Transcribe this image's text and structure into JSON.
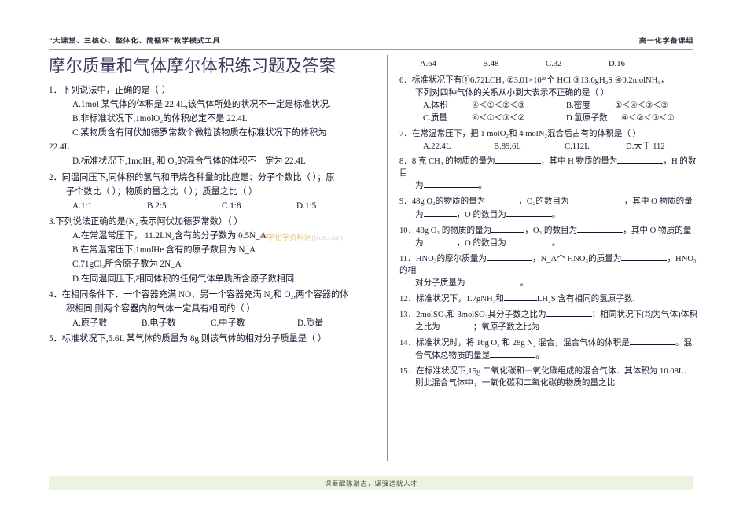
{
  "header": {
    "left": "“大课堂、三核心、整体化、简循环”教学模式工具",
    "right": "高一化学备课组"
  },
  "title": "摩尔质量和气体摩尔体积练习题及答案",
  "watermark": {
    "text": "中学化学资料网",
    "url": "(jxue.com)"
  },
  "footer": {
    "text": "课吾醒陈激志，坚强造就人才"
  },
  "left_column": {
    "q1": {
      "stem": "1．下列说法中，正确的是",
      "paren": "（          ）",
      "options": [
        "A.1mol 某气体的体积是 22.4L,该气体所处的状况不一定是标准状况.",
        "B.非标准状况下,1molO₂的体积必定不是 22.4L",
        "C.某物质含有阿伏加德罗常数个微粒该物质在标准状况下的体积为",
        "22.4L",
        "D.标准状况下,1molH₂ 和 O₂的混合气体的体积不一定为 22.4L"
      ]
    },
    "q2": {
      "line1": "2．同温同压下,同体积的氢气和甲烷各种量的比应是：分子个数比（        ）；原",
      "line2": "子个数比（     ）；物质的量之比（     ）；质量之比（     ）",
      "choices": [
        "A.1:1",
        "B.2:5",
        "C.1:8",
        "D.1:5"
      ]
    },
    "q3": {
      "stem": "3.下列说法正确的是(N",
      "stem_sub": "A",
      "stem_rest": "表示阿伏加德罗常数）（        ）",
      "options": [
        "A.在常温常压下， 11.2LN₂含有的分子数为 0.5N_A",
        "B.在常温常压下,1molHe 含有的原子数目为 N_A",
        "C.71gCl₂所含原子数为 2N_A",
        "D.在同温同压下,相同体积的任何气体单质所含原子数相同"
      ]
    },
    "q4": {
      "line1": "4．在相同条件下．一个容器充满 NO，另一个容器充满 N₂和 O₂,两个容器的体",
      "line2": "积相同.则两个容器内的气体一定具有相同的（      ）",
      "choices": [
        "A.原子数",
        "B.电子数",
        "C.中子数",
        "D.质量"
      ]
    },
    "q5": {
      "stem": "5．标准状况下,5.6L 某气体的质量为 8g.则该气体的相对分子质量是（       ）"
    }
  },
  "right_column": {
    "q5_choices": [
      "A.64",
      "B.48",
      "C.32",
      "D.16"
    ],
    "q6": {
      "line1": "6．标准状况下有①6.72LCH₄  ②3.01×10²³个 HCl ③13.6gH₂S ④0.2molNH₃，",
      "line2": "下列对四种气体的关系从小到大表示不正确的是（       ）",
      "optA_label": "A.体积",
      "optA_value": "④＜①＜②＜③",
      "optB_label": "B.密度",
      "optB_value": "①＜④＜③＜②",
      "optC_label": "C.质量",
      "optC_value": "④＜①＜③＜②",
      "optD_label": "D.氢原子数",
      "optD_value": "④＜②＜③＜①"
    },
    "q7": {
      "stem": "7．在常温常压下，把 1 molO₂和 4 molN₂混合后占有的体积是（        ）",
      "choices": [
        "A.22.4L",
        "B.89.6L",
        "C.112L",
        "D.大于 112"
      ]
    },
    "q8": {
      "line1_a": "8．8 克 CH₄ 的物质的量为",
      "line1_b": "，其中 H 物质的量为",
      "line1_c": "，H 的数目",
      "line2_a": "为",
      "line2_b": "。"
    },
    "q9": {
      "line1_a": "9．48g  O₂的物质的量为",
      "line1_b": "，O₂的数目为",
      "line1_c": "，其中 O 物质的量",
      "line2_a": "为",
      "line2_b": "，O 的数目为",
      "line2_c": "。"
    },
    "q10": {
      "line1_a": "10．48g  O₃ 的物质的量为",
      "line1_b": "，O₃ 的数目为",
      "line1_c": "，其中 O 物质的量",
      "line2_a": "为",
      "line2_b": "，O 的数目为",
      "line2_c": "。"
    },
    "q11": {
      "line1_a": "11．HNO₃的摩尔质量为",
      "line1_b": "，N_A个 HNO₃的质量为",
      "line1_c": "，HNO₃的相",
      "line2_a": "对分子质量为",
      "line2_b": "。"
    },
    "q12": {
      "line1_a": "12．标准状况下，1.7gNH₃和",
      "line1_b": "LH₂S 含有相同的氢原子数."
    },
    "q13": {
      "line1_a": "13．2molSO₃和 3molSO₂其分子数之比为",
      "line1_b": "；相同状况下(均为气体)体积",
      "line2_a": "之比为",
      "line2_b": "；氧原子数之比为",
      "line2_c": "."
    },
    "q14": {
      "line1_a": "14．标准状况时，将 16g O₂ 和 28g N₂ 混合，混合气体的体积是",
      "line1_b": "。混",
      "line2_a": "合气体总物质的量是",
      "line2_b": "。"
    },
    "q15": {
      "line1": "15．在标准状况下,15g 二氧化碳和一氧化碳组成的混合气体．其体积为 10.08L．",
      "line2": "则此混合气体中，一氧化碳和二氧化碳的物质的量之比"
    }
  }
}
